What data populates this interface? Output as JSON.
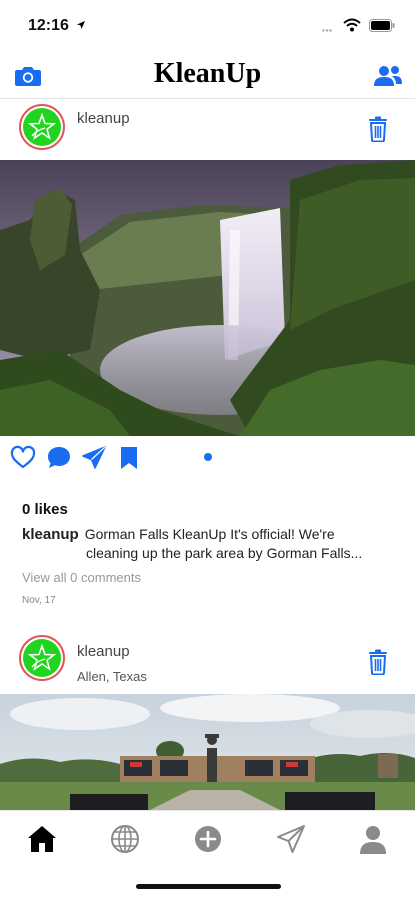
{
  "status_bar": {
    "time": "12:16"
  },
  "header": {
    "title": "KleanUp"
  },
  "posts": [
    {
      "username": "kleanup",
      "location": "",
      "likes": "0 likes",
      "caption_user": "kleanup",
      "caption_line1": "Gorman Falls KleanUp It's official! We're",
      "caption_line2": "cleaning up the park area by Gorman Falls...",
      "view_comments": "View all 0 comments",
      "date": "Nov, 17"
    },
    {
      "username": "kleanup",
      "location": "Allen, Texas"
    }
  ],
  "colors": {
    "accent": "#1a6cf0",
    "avatar_green": "#21d41f",
    "avatar_ring": "#e25555"
  },
  "icons": {
    "header_left": "camera-icon",
    "header_right": "people-icon",
    "post_action": "trash-icon",
    "actions": [
      "heart-icon",
      "comment-icon",
      "send-icon",
      "bookmark-icon"
    ],
    "tabs": [
      "home-icon",
      "globe-icon",
      "add-icon",
      "send-icon",
      "profile-icon"
    ]
  }
}
